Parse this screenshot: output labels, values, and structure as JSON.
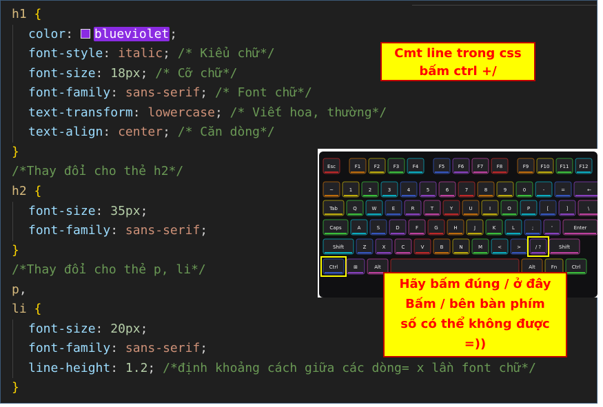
{
  "code_lines": [
    {
      "indent": 0,
      "tokens": [
        {
          "t": "h1",
          "c": "sel"
        },
        {
          "t": " ",
          "c": "pun"
        },
        {
          "t": "{",
          "c": "brace"
        }
      ]
    },
    {
      "indent": 1,
      "tokens": [
        {
          "t": "color",
          "c": "prop"
        },
        {
          "t": ": ",
          "c": "pun"
        },
        {
          "t": "blueviolet",
          "c": "colorval",
          "swatch": true
        },
        {
          "t": ";",
          "c": "pun"
        }
      ]
    },
    {
      "indent": 1,
      "tokens": [
        {
          "t": "font-style",
          "c": "prop"
        },
        {
          "t": ": ",
          "c": "pun"
        },
        {
          "t": "italic",
          "c": "val"
        },
        {
          "t": "; ",
          "c": "pun"
        },
        {
          "t": "/* Kiểu chữ*/",
          "c": "com"
        }
      ]
    },
    {
      "indent": 1,
      "tokens": [
        {
          "t": "font-size",
          "c": "prop"
        },
        {
          "t": ": ",
          "c": "pun"
        },
        {
          "t": "18px",
          "c": "num"
        },
        {
          "t": "; ",
          "c": "pun"
        },
        {
          "t": "/* Cỡ chữ*/",
          "c": "com"
        }
      ]
    },
    {
      "indent": 1,
      "tokens": [
        {
          "t": "font-family",
          "c": "prop"
        },
        {
          "t": ": ",
          "c": "pun"
        },
        {
          "t": "sans-serif",
          "c": "val"
        },
        {
          "t": "; ",
          "c": "pun"
        },
        {
          "t": "/* Font chữ*/",
          "c": "com"
        }
      ]
    },
    {
      "indent": 1,
      "tokens": [
        {
          "t": "text-transform",
          "c": "prop"
        },
        {
          "t": ": ",
          "c": "pun"
        },
        {
          "t": "lowercase",
          "c": "val"
        },
        {
          "t": "; ",
          "c": "pun"
        },
        {
          "t": "/* Viết hoa, thường*/",
          "c": "com"
        }
      ]
    },
    {
      "indent": 1,
      "tokens": [
        {
          "t": "text-align",
          "c": "prop"
        },
        {
          "t": ": ",
          "c": "pun"
        },
        {
          "t": "center",
          "c": "val"
        },
        {
          "t": "; ",
          "c": "pun"
        },
        {
          "t": "/* Căn dòng*/",
          "c": "com"
        }
      ]
    },
    {
      "indent": 0,
      "tokens": [
        {
          "t": "}",
          "c": "brace"
        }
      ]
    },
    {
      "indent": 0,
      "tokens": [
        {
          "t": "/*Thay đổi cho thẻ h2*/",
          "c": "com"
        }
      ]
    },
    {
      "indent": 0,
      "tokens": [
        {
          "t": "h2",
          "c": "sel"
        },
        {
          "t": " ",
          "c": "pun"
        },
        {
          "t": "{",
          "c": "brace"
        }
      ]
    },
    {
      "indent": 1,
      "tokens": [
        {
          "t": "font-size",
          "c": "prop"
        },
        {
          "t": ": ",
          "c": "pun"
        },
        {
          "t": "35px",
          "c": "num"
        },
        {
          "t": ";",
          "c": "pun"
        }
      ]
    },
    {
      "indent": 1,
      "tokens": [
        {
          "t": "font-family",
          "c": "prop"
        },
        {
          "t": ": ",
          "c": "pun"
        },
        {
          "t": "sans-serif",
          "c": "val"
        },
        {
          "t": ";",
          "c": "pun"
        }
      ]
    },
    {
      "indent": 0,
      "tokens": [
        {
          "t": "}",
          "c": "brace"
        }
      ]
    },
    {
      "indent": 0,
      "tokens": [
        {
          "t": "/*Thay đổi cho thẻ p, li*/",
          "c": "com"
        }
      ]
    },
    {
      "indent": 0,
      "tokens": [
        {
          "t": "p",
          "c": "sel"
        },
        {
          "t": ",",
          "c": "pun"
        }
      ]
    },
    {
      "indent": 0,
      "tokens": [
        {
          "t": "li",
          "c": "sel"
        },
        {
          "t": " ",
          "c": "pun"
        },
        {
          "t": "{",
          "c": "brace"
        }
      ]
    },
    {
      "indent": 1,
      "tokens": [
        {
          "t": "font-size",
          "c": "prop"
        },
        {
          "t": ": ",
          "c": "pun"
        },
        {
          "t": "20px",
          "c": "num"
        },
        {
          "t": ";",
          "c": "pun"
        }
      ]
    },
    {
      "indent": 1,
      "tokens": [
        {
          "t": "font-family",
          "c": "prop"
        },
        {
          "t": ": ",
          "c": "pun"
        },
        {
          "t": "sans-serif",
          "c": "val"
        },
        {
          "t": ";",
          "c": "pun"
        }
      ]
    },
    {
      "indent": 1,
      "tokens": [
        {
          "t": "line-height",
          "c": "prop"
        },
        {
          "t": ": ",
          "c": "pun"
        },
        {
          "t": "1.2",
          "c": "num"
        },
        {
          "t": "; ",
          "c": "pun"
        },
        {
          "t": "/*định khoảng cách giữa các dòng= x lần font chữ*/",
          "c": "com"
        }
      ]
    },
    {
      "indent": 0,
      "tokens": [
        {
          "t": "}",
          "c": "brace"
        }
      ]
    }
  ],
  "colors": {
    "editor_bg": "#1f1f1f",
    "swatch_blueviolet": "#8a2be2",
    "note_bg": "#ffff00",
    "note_text": "#ff0000",
    "key_highlight": "#ffff00"
  },
  "notes": {
    "top": [
      "Cmt line trong css",
      "bấm ctrl +/"
    ],
    "bottom": [
      "Hãy bấm đúng / ở đây",
      "Bấm / bên bàn phím",
      "số có thể không được",
      "=))"
    ]
  },
  "keyboard": {
    "rows": [
      [
        "Esc",
        "F1",
        "F2",
        "F3",
        "F4",
        "F5",
        "F6",
        "F7",
        "F8",
        "F9",
        "F10",
        "F11",
        "F12"
      ],
      [
        "~",
        "1",
        "2",
        "3",
        "4",
        "5",
        "6",
        "7",
        "8",
        "9",
        "0",
        "-",
        "=",
        "←"
      ],
      [
        "Tab",
        "Q",
        "W",
        "E",
        "R",
        "T",
        "Y",
        "U",
        "I",
        "O",
        "P",
        "[",
        "]",
        "\\"
      ],
      [
        "Caps",
        "A",
        "S",
        "D",
        "F",
        "G",
        "H",
        "J",
        "K",
        "L",
        ";",
        "'",
        "Enter"
      ],
      [
        "Shift",
        "Z",
        "X",
        "C",
        "V",
        "B",
        "N",
        "M",
        "<",
        ">",
        "/ ?",
        "Shift"
      ],
      [
        "Ctrl",
        "⊞",
        "Alt",
        "",
        "Alt",
        "Fn",
        "Ctrl"
      ]
    ],
    "highlighted_keys": [
      "Ctrl",
      "/ ?"
    ]
  }
}
